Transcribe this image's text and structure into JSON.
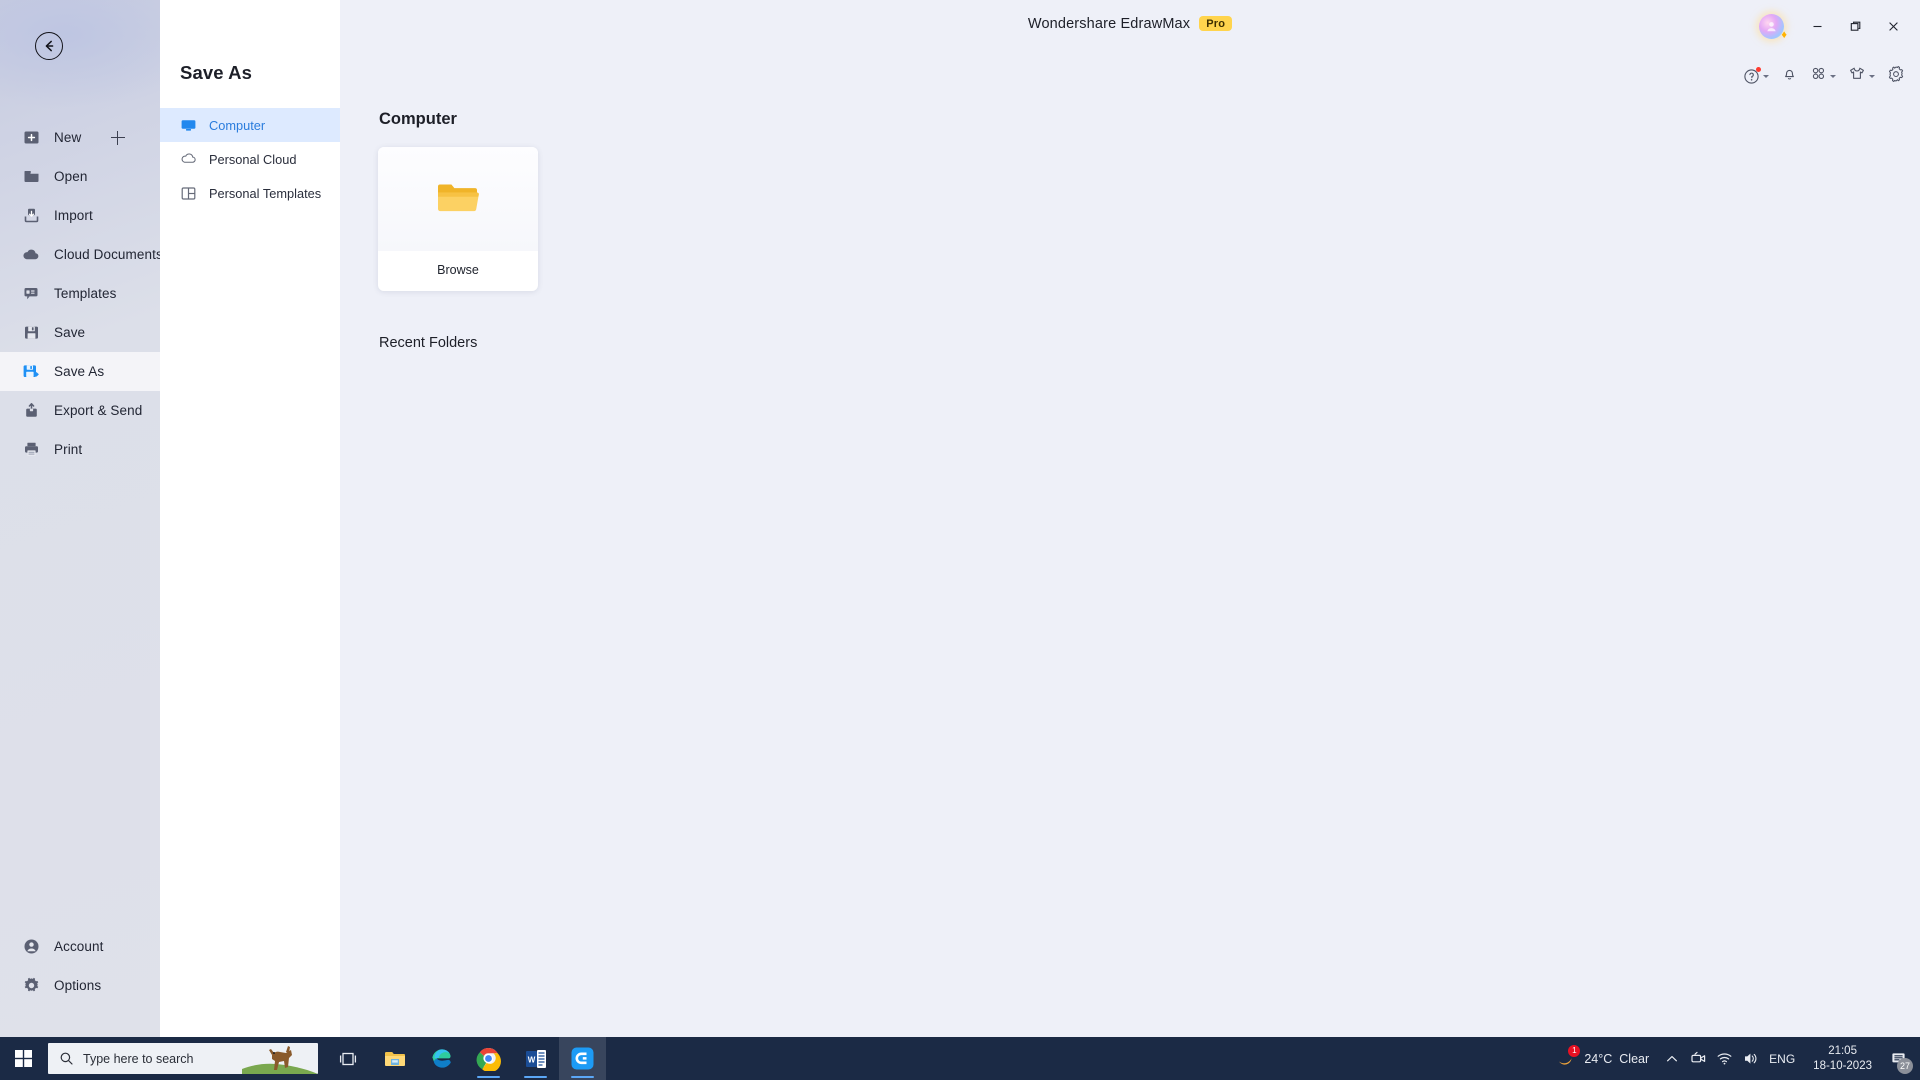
{
  "window": {
    "app_title": "Wondershare EdrawMax",
    "pro_badge": "Pro",
    "minimize_label": "Minimize",
    "maximize_label": "Restore",
    "close_label": "Close"
  },
  "toolstrip": [
    {
      "name": "help-icon",
      "label": "Help"
    },
    {
      "name": "bell-icon",
      "label": "Notifications"
    },
    {
      "name": "apps-grid-icon",
      "label": "Apps"
    },
    {
      "name": "theme-shirt-icon",
      "label": "Theme"
    },
    {
      "name": "gear-icon",
      "label": "Settings"
    }
  ],
  "rail": {
    "back_label": "Back",
    "items": [
      {
        "label": "New",
        "icon": "new-icon",
        "has_plus": true,
        "active": false
      },
      {
        "label": "Open",
        "icon": "folder-icon",
        "active": false
      },
      {
        "label": "Import",
        "icon": "import-icon",
        "active": false
      },
      {
        "label": "Cloud Documents",
        "icon": "cloud-icon",
        "active": false
      },
      {
        "label": "Templates",
        "icon": "templates-icon",
        "active": false
      },
      {
        "label": "Save",
        "icon": "save-icon",
        "active": false
      },
      {
        "label": "Save As",
        "icon": "save-as-icon",
        "active": true
      },
      {
        "label": "Export & Send",
        "icon": "export-icon",
        "active": false
      },
      {
        "label": "Print",
        "icon": "print-icon",
        "active": false
      }
    ],
    "bottom_items": [
      {
        "label": "Account",
        "icon": "account-icon"
      },
      {
        "label": "Options",
        "icon": "options-gear-icon"
      }
    ]
  },
  "nav_panel": {
    "title": "Save As",
    "items": [
      {
        "label": "Computer",
        "icon": "monitor-icon",
        "active": true
      },
      {
        "label": "Personal Cloud",
        "icon": "cloud-outline-icon",
        "active": false
      },
      {
        "label": "Personal Templates",
        "icon": "template-panel-icon",
        "active": false
      }
    ]
  },
  "main": {
    "heading": "Computer",
    "browse_card": {
      "label": "Browse",
      "icon": "folder-open-icon"
    },
    "recent_folders_heading": "Recent Folders"
  },
  "taskbar": {
    "start_label": "Start",
    "search_placeholder": "Type here to search",
    "task_view_label": "Task View",
    "apps": [
      {
        "name": "file-explorer-icon",
        "label": "File Explorer",
        "active": false,
        "running": false
      },
      {
        "name": "edge-icon",
        "label": "Microsoft Edge",
        "active": false,
        "running": false
      },
      {
        "name": "chrome-icon",
        "label": "Google Chrome",
        "active": false,
        "running": true
      },
      {
        "name": "word-icon",
        "label": "Microsoft Word",
        "active": false,
        "running": true
      },
      {
        "name": "edrawmax-icon",
        "label": "Wondershare EdrawMax",
        "active": true,
        "running": true
      }
    ],
    "weather": {
      "temperature": "24°C",
      "condition": "Clear",
      "badge_count": "1"
    },
    "tray": {
      "show_hidden_label": "Show hidden icons",
      "meet_now_label": "Meet Now",
      "network_label": "Network",
      "volume_label": "Volume",
      "language": "ENG"
    },
    "clock": {
      "time": "21:05",
      "date": "18-10-2023"
    },
    "notifications_count": "27"
  },
  "colors": {
    "accent_blue": "#2a7cdd",
    "nav_active_bg": "#ddeaff",
    "pro_yellow": "#ffd44d",
    "taskbar_bg": "#1b2a45",
    "folder_yellow": "#f7c244"
  }
}
